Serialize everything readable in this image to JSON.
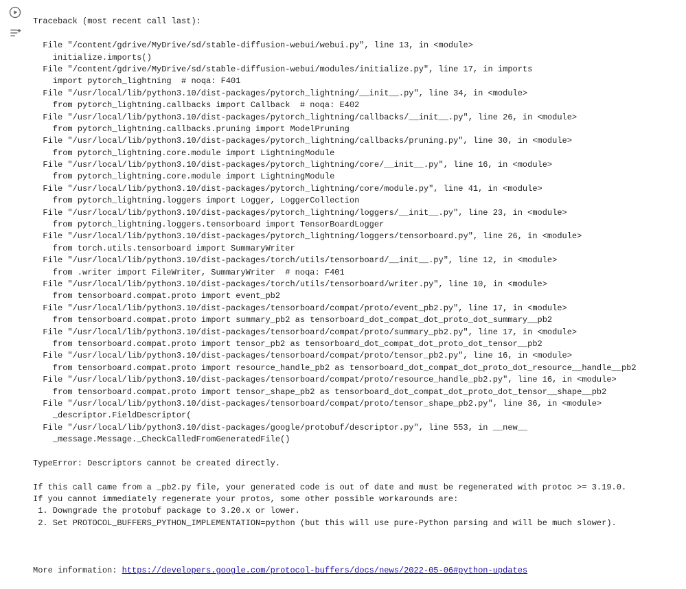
{
  "traceback": {
    "header": "Traceback (most recent call last):",
    "frames": [
      {
        "loc": "  File \"/content/gdrive/MyDrive/sd/stable-diffusion-webui/webui.py\", line 13, in <module>",
        "code": "    initialize.imports()"
      },
      {
        "loc": "  File \"/content/gdrive/MyDrive/sd/stable-diffusion-webui/modules/initialize.py\", line 17, in imports",
        "code": "    import pytorch_lightning  # noqa: F401"
      },
      {
        "loc": "  File \"/usr/local/lib/python3.10/dist-packages/pytorch_lightning/__init__.py\", line 34, in <module>",
        "code": "    from pytorch_lightning.callbacks import Callback  # noqa: E402"
      },
      {
        "loc": "  File \"/usr/local/lib/python3.10/dist-packages/pytorch_lightning/callbacks/__init__.py\", line 26, in <module>",
        "code": "    from pytorch_lightning.callbacks.pruning import ModelPruning"
      },
      {
        "loc": "  File \"/usr/local/lib/python3.10/dist-packages/pytorch_lightning/callbacks/pruning.py\", line 30, in <module>",
        "code": "    from pytorch_lightning.core.module import LightningModule"
      },
      {
        "loc": "  File \"/usr/local/lib/python3.10/dist-packages/pytorch_lightning/core/__init__.py\", line 16, in <module>",
        "code": "    from pytorch_lightning.core.module import LightningModule"
      },
      {
        "loc": "  File \"/usr/local/lib/python3.10/dist-packages/pytorch_lightning/core/module.py\", line 41, in <module>",
        "code": "    from pytorch_lightning.loggers import Logger, LoggerCollection"
      },
      {
        "loc": "  File \"/usr/local/lib/python3.10/dist-packages/pytorch_lightning/loggers/__init__.py\", line 23, in <module>",
        "code": "    from pytorch_lightning.loggers.tensorboard import TensorBoardLogger"
      },
      {
        "loc": "  File \"/usr/local/lib/python3.10/dist-packages/pytorch_lightning/loggers/tensorboard.py\", line 26, in <module>",
        "code": "    from torch.utils.tensorboard import SummaryWriter"
      },
      {
        "loc": "  File \"/usr/local/lib/python3.10/dist-packages/torch/utils/tensorboard/__init__.py\", line 12, in <module>",
        "code": "    from .writer import FileWriter, SummaryWriter  # noqa: F401"
      },
      {
        "loc": "  File \"/usr/local/lib/python3.10/dist-packages/torch/utils/tensorboard/writer.py\", line 10, in <module>",
        "code": "    from tensorboard.compat.proto import event_pb2"
      },
      {
        "loc": "  File \"/usr/local/lib/python3.10/dist-packages/tensorboard/compat/proto/event_pb2.py\", line 17, in <module>",
        "code": "    from tensorboard.compat.proto import summary_pb2 as tensorboard_dot_compat_dot_proto_dot_summary__pb2"
      },
      {
        "loc": "  File \"/usr/local/lib/python3.10/dist-packages/tensorboard/compat/proto/summary_pb2.py\", line 17, in <module>",
        "code": "    from tensorboard.compat.proto import tensor_pb2 as tensorboard_dot_compat_dot_proto_dot_tensor__pb2"
      },
      {
        "loc": "  File \"/usr/local/lib/python3.10/dist-packages/tensorboard/compat/proto/tensor_pb2.py\", line 16, in <module>",
        "code": "    from tensorboard.compat.proto import resource_handle_pb2 as tensorboard_dot_compat_dot_proto_dot_resource__handle__pb2"
      },
      {
        "loc": "  File \"/usr/local/lib/python3.10/dist-packages/tensorboard/compat/proto/resource_handle_pb2.py\", line 16, in <module>",
        "code": "    from tensorboard.compat.proto import tensor_shape_pb2 as tensorboard_dot_compat_dot_proto_dot_tensor__shape__pb2"
      },
      {
        "loc": "  File \"/usr/local/lib/python3.10/dist-packages/tensorboard/compat/proto/tensor_shape_pb2.py\", line 36, in <module>",
        "code": "    _descriptor.FieldDescriptor("
      },
      {
        "loc": "  File \"/usr/local/lib/python3.10/dist-packages/google/protobuf/descriptor.py\", line 553, in __new__",
        "code": "    _message.Message._CheckCalledFromGeneratedFile()"
      }
    ],
    "error": "TypeError: Descriptors cannot be created directly.",
    "advice": [
      "If this call came from a _pb2.py file, your generated code is out of date and must be regenerated with protoc >= 3.19.0.",
      "If you cannot immediately regenerate your protos, some other possible workarounds are:",
      " 1. Downgrade the protobuf package to 3.20.x or lower.",
      " 2. Set PROTOCOL_BUFFERS_PYTHON_IMPLEMENTATION=python (but this will use pure-Python parsing and will be much slower)."
    ],
    "more_info_label": "More information: ",
    "more_info_url": "https://developers.google.com/protocol-buffers/docs/news/2022-05-06#python-updates"
  },
  "icons": {
    "run": "play-circle",
    "var_inspect": "variable-inspect"
  }
}
